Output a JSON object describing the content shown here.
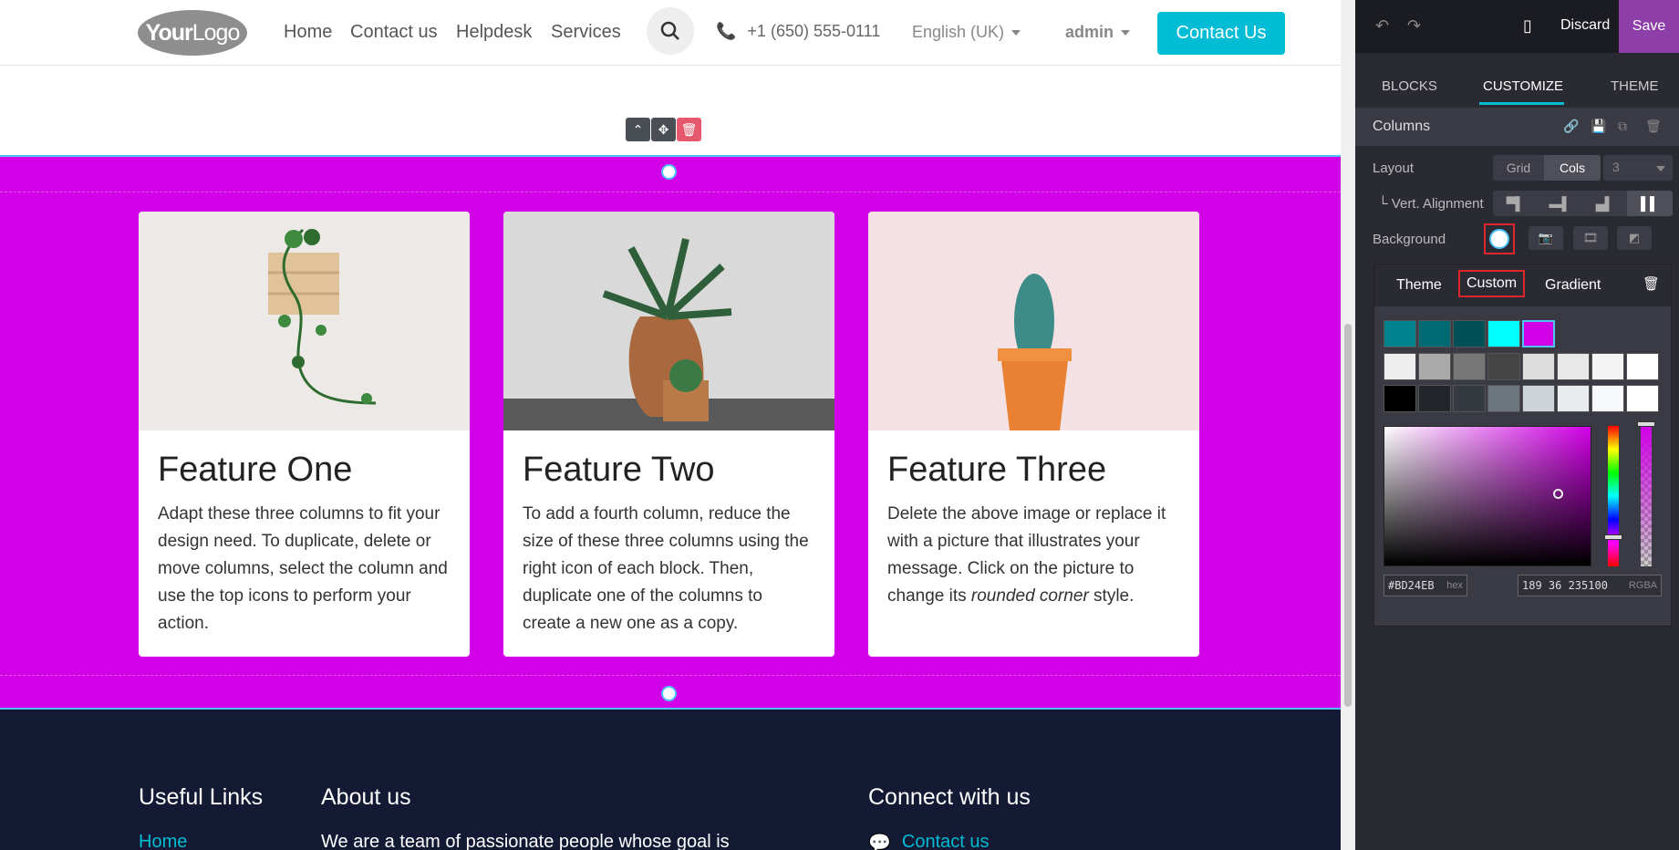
{
  "header": {
    "logo_main": "Your",
    "logo_sub": "Logo",
    "nav": [
      "Home",
      "Contact us",
      "Helpdesk",
      "Services"
    ],
    "phone": "+1 (650) 555-0111",
    "language": "English (UK)",
    "user": "admin",
    "cta": "Contact Us"
  },
  "features": [
    {
      "title": "Feature One",
      "text": "Adapt these three columns to fit your design need. To duplicate, delete or move columns, select the column and use the top icons to perform your action."
    },
    {
      "title": "Feature Two",
      "text": "To add a fourth column, reduce the size of these three columns using the right icon of each block. Then, duplicate one of the columns to create a new one as a copy."
    },
    {
      "title": "Feature Three",
      "text_before": "Delete the above image or replace it with a picture that illustrates your message. Click on the picture to change its ",
      "text_em": "rounded corner",
      "text_after": " style."
    }
  ],
  "footer": {
    "useful_links": "Useful Links",
    "home": "Home",
    "about": "About us",
    "about_text": "We are a team of passionate people whose goal is",
    "connect": "Connect with us",
    "contact": "Contact us"
  },
  "editor": {
    "discard": "Discard",
    "save": "Save",
    "tabs": [
      "BLOCKS",
      "CUSTOMIZE",
      "THEME"
    ],
    "section_title": "Columns",
    "layout_label": "Layout",
    "layout_grid": "Grid",
    "layout_cols": "Cols",
    "cols_value": "3",
    "vert_label": "└ Vert. Alignment",
    "bg_label": "Background",
    "picker_tabs": [
      "Theme",
      "Custom",
      "Gradient"
    ],
    "hex": "#BD24EB",
    "hex_suffix": "hex",
    "rgba": "189 36 235100",
    "rgba_suffix": "RGBA"
  },
  "colors": {
    "section_bg": "#d100e6",
    "accent": "#00bcd4",
    "save_bg": "#8e3ea8"
  },
  "swatches": {
    "row1": [
      "#00838f",
      "#006a73",
      "#005058",
      "#00ffff",
      "#d100e6"
    ],
    "row2": [
      "#eeeeee",
      "#aaaaaa",
      "#777777",
      "#444444",
      "#dddddd",
      "#e8e8e8",
      "#f4f4f4",
      "#ffffff"
    ],
    "row3": [
      "#000000",
      "#222529",
      "#343a40",
      "#6c757d",
      "#ced4da",
      "#e9ecef",
      "#f8f9fa",
      "#ffffff"
    ]
  }
}
